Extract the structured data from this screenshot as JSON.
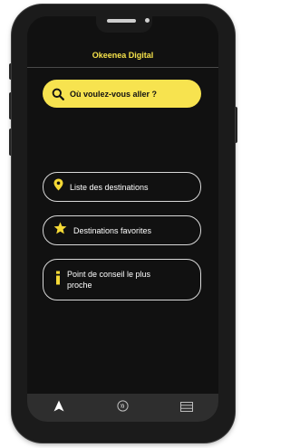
{
  "header": {
    "app_title": "Okeenea Digital"
  },
  "search": {
    "label": "Où voulez-vous aller ?",
    "icon": "search-icon"
  },
  "menu": [
    {
      "label": "Liste des destinations",
      "icon": "location-pin-icon",
      "icon_color": "#f5d936"
    },
    {
      "label": "Destinations favorites",
      "icon": "star-icon",
      "icon_color": "#f5d936"
    },
    {
      "label": "Point de conseil le plus proche",
      "icon": "info-icon",
      "icon_color": "#f5d936"
    }
  ],
  "bottom_nav": [
    {
      "name": "navigation",
      "icon": "navigation-arrow-icon",
      "active": true
    },
    {
      "name": "beacon",
      "icon": "beacon-icon",
      "active": false
    },
    {
      "name": "list",
      "icon": "list-icon",
      "active": false
    }
  ],
  "colors": {
    "accent": "#f7e34f",
    "title": "#f5e14a",
    "screen_bg": "#111111",
    "nav_bg": "#2e2e2e"
  }
}
